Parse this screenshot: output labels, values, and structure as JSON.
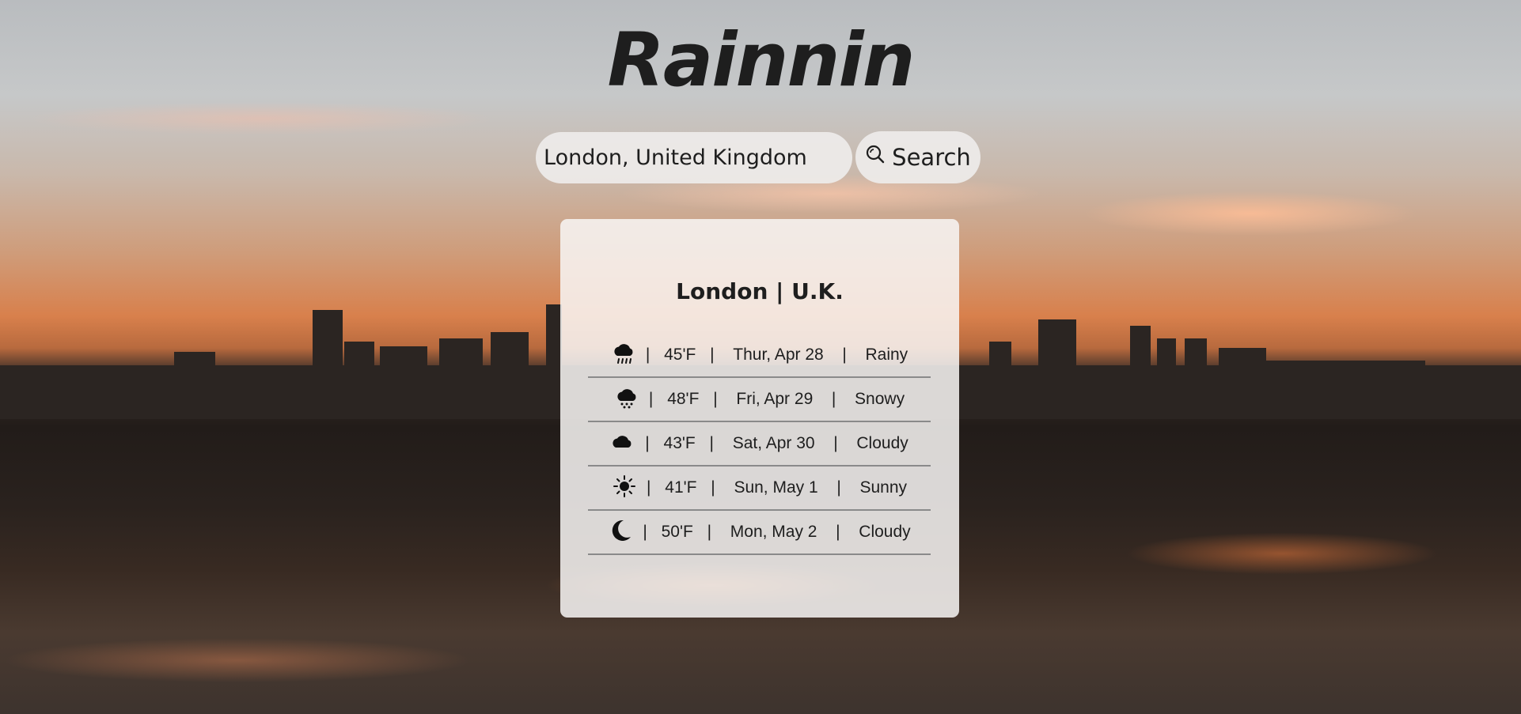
{
  "app": {
    "title": "Rainnin"
  },
  "search": {
    "value": "London, United Kingdom",
    "button_label": "Search"
  },
  "location": {
    "title": "London | U.K."
  },
  "forecast": [
    {
      "icon": "rain-cloud-icon",
      "temp": "45'F",
      "date": "Thur, Apr 28",
      "condition": "Rainy"
    },
    {
      "icon": "snow-cloud-icon",
      "temp": "48'F",
      "date": "Fri, Apr 29",
      "condition": "Snowy"
    },
    {
      "icon": "cloud-icon",
      "temp": "43'F",
      "date": "Sat, Apr 30",
      "condition": "Cloudy"
    },
    {
      "icon": "sun-icon",
      "temp": "41'F",
      "date": "Sun, May 1",
      "condition": "Sunny"
    },
    {
      "icon": "moon-icon",
      "temp": "50'F",
      "date": "Mon, May 2",
      "condition": "Cloudy"
    }
  ]
}
